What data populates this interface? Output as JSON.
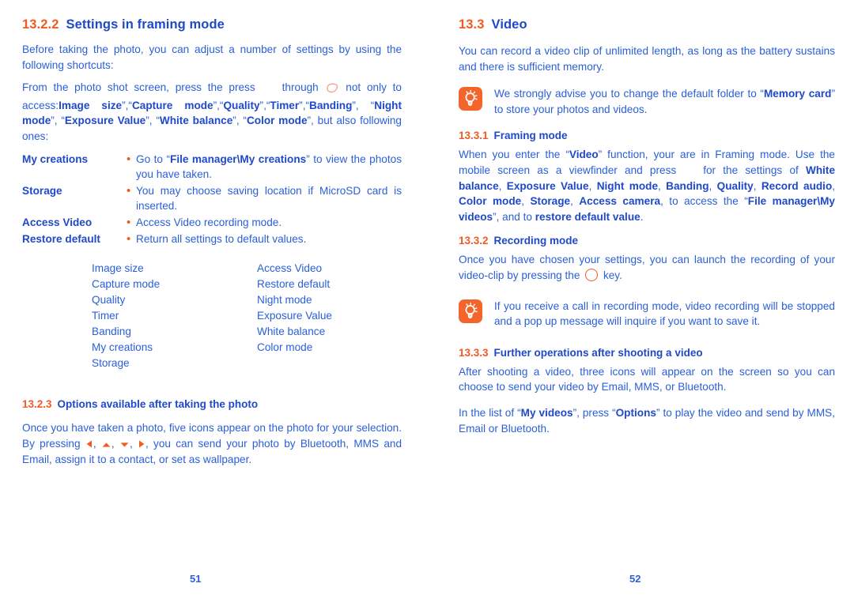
{
  "colors": {
    "accent_orange": "#f15a24",
    "heading_blue": "#1f49c9",
    "body_blue": "#2a5fd8",
    "tip_icon_bg": "#f4652b",
    "page_bg": "#ffffff"
  },
  "left_page": {
    "page_number": "51",
    "section": {
      "number": "13.2.2",
      "title": "Settings in framing mode"
    },
    "intro": {
      "line1": "Before taking the photo, you can adjust a number of settings by using the following shortcuts:",
      "line2_a": "From the photo shot screen, press the press",
      "line2_b": "through",
      "line2_c": "not only to access:",
      "options_quoted": [
        "Image size",
        "Capture mode",
        "Quality",
        "Timer",
        "Banding",
        "Night mode",
        "Exposure Value",
        "White balance",
        "Color mode"
      ],
      "line_end": "but also following ones:"
    },
    "definitions": [
      {
        "term": "My creations",
        "bullet": "•",
        "desc_pre": "Go to “",
        "desc_bold": "File manager\\My creations",
        "desc_post": "” to view the photos you have taken."
      },
      {
        "term": "Storage",
        "bullet": "•",
        "desc_pre": "",
        "desc_bold": "",
        "desc_post": "You may choose saving location if MicroSD card is inserted."
      },
      {
        "term": "Access Video",
        "bullet": "•",
        "desc_pre": "",
        "desc_bold": "",
        "desc_post": "Access Video recording mode."
      },
      {
        "term": "Restore default",
        "bullet": "•",
        "desc_pre": "",
        "desc_bold": "",
        "desc_post": "Return all settings to default values."
      }
    ],
    "settings_list": {
      "column_left": [
        "Image size",
        "Capture mode",
        "Quality",
        "Timer",
        "Banding",
        "My creations",
        "Storage"
      ],
      "column_right": [
        "Access Video",
        "Restore default",
        "Night mode",
        "Exposure Value",
        "White balance",
        "Color mode"
      ]
    },
    "section2": {
      "number": "13.2.3",
      "title": "Options available after taking the photo",
      "para_a": "Once you have taken a photo, five icons appear on the photo for your selection. By pressing",
      "para_b": ", you can send your photo by Bluetooth, MMS and Email, assign it to a contact, or set as wallpaper.",
      "arrow_icons": [
        "arrow-left-icon",
        "arrow-up-icon",
        "arrow-down-icon",
        "arrow-right-icon"
      ]
    }
  },
  "right_page": {
    "page_number": "52",
    "section": {
      "number": "13.3",
      "title": "Video"
    },
    "intro": "You can record a video clip of unlimited length, as long as the battery sustains and there is sufficient memory.",
    "tip1": {
      "icon": "lightbulb-tip-icon",
      "pre": "We strongly advise you to change the default folder to “",
      "bold": "Memory card",
      "post": "” to store your photos and videos."
    },
    "framing": {
      "number": "13.3.1",
      "title": "Framing mode",
      "t1": "When you enter the “",
      "b1": "Video",
      "t2": "” function, your are in Framing mode. Use the mobile screen as a viewfinder and press",
      "t3": "for the settings of ",
      "b2": "White balance",
      "t4": ", ",
      "b3": "Exposure Value",
      "b4": "Night mode",
      "b5": "Banding",
      "b6": "Quality",
      "b7": "Record audio",
      "b8": "Color mode",
      "b9": "Storage",
      "b10": "Access camera",
      "t5": ", to access the “",
      "b11": "File manager\\My videos",
      "t6": "”, and to ",
      "b12": "restore default value",
      "t7": "."
    },
    "recording": {
      "number": "13.3.2",
      "title": "Recording mode",
      "t1": "Once you have chosen your settings, you can launch the recording of your video-clip by pressing the",
      "icon": "circle-key-icon",
      "t2": "key."
    },
    "tip2": {
      "icon": "lightbulb-tip-icon",
      "text": "If you receive a call in recording mode, video recording will be stopped and a pop up message will inquire if you want to save it."
    },
    "further": {
      "number": "13.3.3",
      "title": "Further operations after shooting a video",
      "para1": "After shooting a video, three icons will appear on the screen so you can choose to send your video by Email, MMS, or Bluetooth.",
      "p2_a": "In the list of “",
      "p2_b1": "My videos",
      "p2_b": "”, press “",
      "p2_b2": "Options",
      "p2_c": "” to play the video and send by MMS, Email or Bluetooth."
    }
  }
}
